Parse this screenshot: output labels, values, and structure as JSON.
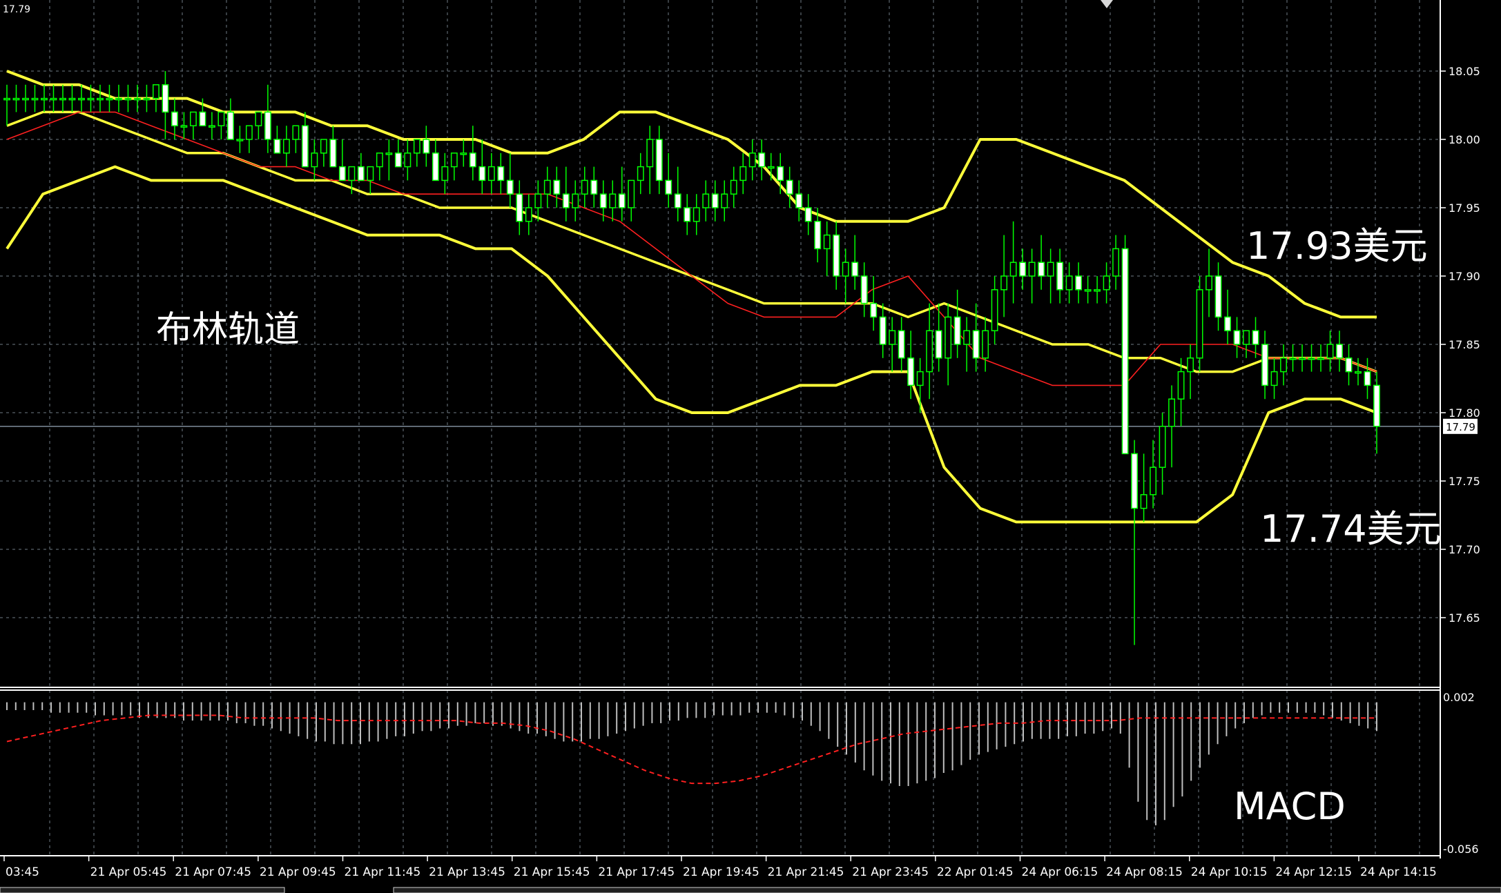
{
  "chart_data": {
    "type": "candlestick",
    "instrument_price_label": "17.79",
    "price_axis": {
      "ticks": [
        "18.05",
        "18.00",
        "17.95",
        "17.90",
        "17.85",
        "17.80",
        "17.75",
        "17.70",
        "17.65"
      ],
      "tick_values": [
        18.05,
        18.0,
        17.95,
        17.9,
        17.85,
        17.8,
        17.75,
        17.7,
        17.65
      ],
      "ylim": [
        17.6,
        18.1
      ],
      "current_price": 17.79,
      "current_price_label": "17.79"
    },
    "time_axis": {
      "labels": [
        "03:45",
        "21 Apr 05:45",
        "21 Apr 07:45",
        "21 Apr 09:45",
        "21 Apr 11:45",
        "21 Apr 13:45",
        "21 Apr 15:45",
        "21 Apr 17:45",
        "21 Apr 19:45",
        "21 Apr 21:45",
        "21 Apr 23:45",
        "22 Apr 01:45",
        "24 Apr 06:15",
        "24 Apr 08:15",
        "24 Apr 10:15",
        "24 Apr 12:15",
        "24 Apr 14:15"
      ]
    },
    "bollinger_upper": [
      18.05,
      18.04,
      18.04,
      18.03,
      18.03,
      18.03,
      18.02,
      18.02,
      18.02,
      18.01,
      18.01,
      18.0,
      18.0,
      18.0,
      17.99,
      17.99,
      18.0,
      18.02,
      18.02,
      18.01,
      18.0,
      17.98,
      17.95,
      17.94,
      17.94,
      17.94,
      17.95,
      18.0,
      18.0,
      17.99,
      17.98,
      17.97,
      17.95,
      17.93,
      17.91,
      17.9,
      17.88,
      17.87,
      17.87
    ],
    "bollinger_middle": [
      18.01,
      18.02,
      18.02,
      18.01,
      18.0,
      17.99,
      17.99,
      17.98,
      17.97,
      17.97,
      17.96,
      17.96,
      17.95,
      17.95,
      17.95,
      17.94,
      17.93,
      17.92,
      17.91,
      17.9,
      17.89,
      17.88,
      17.88,
      17.88,
      17.88,
      17.87,
      17.88,
      17.87,
      17.86,
      17.85,
      17.85,
      17.84,
      17.84,
      17.83,
      17.83,
      17.84,
      17.84,
      17.84,
      17.83
    ],
    "bollinger_lower": [
      17.92,
      17.96,
      17.97,
      17.98,
      17.97,
      17.97,
      17.97,
      17.96,
      17.95,
      17.94,
      17.93,
      17.93,
      17.93,
      17.92,
      17.92,
      17.9,
      17.87,
      17.84,
      17.81,
      17.8,
      17.8,
      17.81,
      17.82,
      17.82,
      17.83,
      17.83,
      17.76,
      17.73,
      17.72,
      17.72,
      17.72,
      17.72,
      17.72,
      17.72,
      17.74,
      17.8,
      17.81,
      17.81,
      17.8
    ],
    "sma_red": [
      18.0,
      18.01,
      18.02,
      18.02,
      18.01,
      18.0,
      17.99,
      17.98,
      17.98,
      17.97,
      17.97,
      17.96,
      17.96,
      17.96,
      17.96,
      17.96,
      17.95,
      17.94,
      17.92,
      17.9,
      17.88,
      17.87,
      17.87,
      17.87,
      17.89,
      17.9,
      17.87,
      17.84,
      17.83,
      17.82,
      17.82,
      17.82,
      17.85,
      17.85,
      17.85,
      17.84,
      17.84,
      17.84,
      17.83
    ],
    "candles": [
      [
        18.03,
        18.04,
        18.01,
        18.03
      ],
      [
        18.03,
        18.04,
        18.02,
        18.03
      ],
      [
        18.03,
        18.04,
        18.02,
        18.03
      ],
      [
        18.03,
        18.04,
        18.02,
        18.03
      ],
      [
        18.03,
        18.04,
        18.02,
        18.03
      ],
      [
        18.03,
        18.04,
        18.02,
        18.03
      ],
      [
        18.03,
        18.04,
        18.02,
        18.03
      ],
      [
        18.03,
        18.04,
        18.02,
        18.03
      ],
      [
        18.03,
        18.04,
        18.02,
        18.03
      ],
      [
        18.03,
        18.04,
        18.02,
        18.03
      ],
      [
        18.03,
        18.04,
        18.02,
        18.03
      ],
      [
        18.03,
        18.04,
        18.02,
        18.03
      ],
      [
        18.03,
        18.04,
        18.02,
        18.03
      ],
      [
        18.03,
        18.04,
        18.02,
        18.03
      ],
      [
        18.03,
        18.04,
        18.02,
        18.03
      ],
      [
        18.03,
        18.04,
        18.02,
        18.03
      ],
      [
        18.03,
        18.04,
        18.02,
        18.04
      ],
      [
        18.04,
        18.05,
        18.0,
        18.02
      ],
      [
        18.02,
        18.03,
        18.0,
        18.01
      ],
      [
        18.01,
        18.02,
        18.0,
        18.01
      ],
      [
        18.01,
        18.02,
        18.0,
        18.02
      ],
      [
        18.02,
        18.03,
        18.01,
        18.01
      ],
      [
        18.01,
        18.02,
        18.0,
        18.01
      ],
      [
        18.01,
        18.02,
        18.0,
        18.02
      ],
      [
        18.02,
        18.03,
        18.0,
        18.0
      ],
      [
        18.0,
        18.01,
        17.99,
        18.0
      ],
      [
        18.0,
        18.01,
        17.99,
        18.01
      ],
      [
        18.01,
        18.02,
        18.0,
        18.02
      ],
      [
        18.02,
        18.04,
        17.99,
        18.0
      ],
      [
        18.0,
        18.01,
        17.99,
        17.99
      ],
      [
        17.99,
        18.01,
        17.98,
        18.0
      ],
      [
        18.0,
        18.01,
        17.99,
        18.01
      ],
      [
        18.01,
        18.02,
        17.98,
        17.98
      ],
      [
        17.98,
        18.0,
        17.97,
        17.99
      ],
      [
        17.99,
        18.0,
        17.98,
        18.0
      ],
      [
        18.0,
        18.01,
        17.98,
        17.98
      ],
      [
        17.98,
        18.0,
        17.97,
        17.97
      ],
      [
        17.97,
        17.98,
        17.96,
        17.98
      ],
      [
        17.98,
        17.99,
        17.97,
        17.97
      ],
      [
        17.97,
        17.98,
        17.96,
        17.98
      ],
      [
        17.98,
        17.99,
        17.97,
        17.99
      ],
      [
        17.99,
        18.0,
        17.97,
        17.99
      ],
      [
        17.99,
        18.0,
        17.98,
        17.98
      ],
      [
        17.98,
        18.0,
        17.97,
        17.99
      ],
      [
        17.99,
        18.0,
        17.98,
        18.0
      ],
      [
        18.0,
        18.01,
        17.98,
        17.99
      ],
      [
        17.99,
        18.0,
        17.97,
        17.97
      ],
      [
        17.97,
        17.99,
        17.96,
        17.98
      ],
      [
        17.98,
        17.99,
        17.97,
        17.99
      ],
      [
        17.99,
        18.0,
        17.98,
        17.99
      ],
      [
        17.99,
        18.01,
        17.97,
        17.98
      ],
      [
        17.98,
        18.0,
        17.96,
        17.97
      ],
      [
        17.97,
        17.99,
        17.96,
        17.98
      ],
      [
        17.98,
        17.99,
        17.96,
        17.97
      ],
      [
        17.97,
        17.99,
        17.95,
        17.96
      ],
      [
        17.96,
        17.97,
        17.93,
        17.94
      ],
      [
        17.94,
        17.96,
        17.93,
        17.95
      ],
      [
        17.95,
        17.97,
        17.94,
        17.96
      ],
      [
        17.96,
        17.98,
        17.95,
        17.97
      ],
      [
        17.97,
        17.98,
        17.95,
        17.96
      ],
      [
        17.96,
        17.98,
        17.94,
        17.95
      ],
      [
        17.95,
        17.97,
        17.94,
        17.96
      ],
      [
        17.96,
        17.98,
        17.95,
        17.97
      ],
      [
        17.97,
        17.98,
        17.95,
        17.96
      ],
      [
        17.96,
        17.97,
        17.94,
        17.95
      ],
      [
        17.95,
        17.97,
        17.94,
        17.96
      ],
      [
        17.96,
        17.98,
        17.94,
        17.95
      ],
      [
        17.95,
        17.97,
        17.94,
        17.97
      ],
      [
        17.97,
        17.99,
        17.96,
        17.98
      ],
      [
        17.98,
        18.01,
        17.96,
        18.0
      ],
      [
        18.0,
        18.01,
        17.96,
        17.97
      ],
      [
        17.97,
        17.99,
        17.95,
        17.96
      ],
      [
        17.96,
        17.98,
        17.94,
        17.95
      ],
      [
        17.95,
        17.96,
        17.93,
        17.94
      ],
      [
        17.94,
        17.96,
        17.93,
        17.95
      ],
      [
        17.95,
        17.97,
        17.94,
        17.96
      ],
      [
        17.96,
        17.97,
        17.94,
        17.95
      ],
      [
        17.95,
        17.97,
        17.94,
        17.96
      ],
      [
        17.96,
        17.98,
        17.95,
        17.97
      ],
      [
        17.97,
        17.99,
        17.96,
        17.98
      ],
      [
        17.98,
        18.0,
        17.97,
        17.99
      ],
      [
        17.99,
        18.0,
        17.97,
        17.98
      ],
      [
        17.98,
        17.99,
        17.97,
        17.98
      ],
      [
        17.98,
        17.99,
        17.96,
        17.97
      ],
      [
        17.97,
        17.98,
        17.95,
        17.96
      ],
      [
        17.96,
        17.97,
        17.94,
        17.95
      ],
      [
        17.95,
        17.96,
        17.93,
        17.94
      ],
      [
        17.94,
        17.95,
        17.91,
        17.92
      ],
      [
        17.92,
        17.94,
        17.9,
        17.93
      ],
      [
        17.93,
        17.94,
        17.89,
        17.9
      ],
      [
        17.9,
        17.92,
        17.88,
        17.91
      ],
      [
        17.91,
        17.93,
        17.89,
        17.9
      ],
      [
        17.9,
        17.91,
        17.87,
        17.88
      ],
      [
        17.88,
        17.9,
        17.86,
        17.87
      ],
      [
        17.87,
        17.88,
        17.84,
        17.85
      ],
      [
        17.85,
        17.87,
        17.83,
        17.86
      ],
      [
        17.86,
        17.87,
        17.83,
        17.84
      ],
      [
        17.84,
        17.86,
        17.81,
        17.82
      ],
      [
        17.82,
        17.84,
        17.8,
        17.83
      ],
      [
        17.83,
        17.88,
        17.81,
        17.86
      ],
      [
        17.86,
        17.88,
        17.83,
        17.84
      ],
      [
        17.84,
        17.88,
        17.82,
        17.87
      ],
      [
        17.87,
        17.89,
        17.84,
        17.85
      ],
      [
        17.85,
        17.87,
        17.83,
        17.86
      ],
      [
        17.86,
        17.88,
        17.83,
        17.84
      ],
      [
        17.84,
        17.87,
        17.83,
        17.86
      ],
      [
        17.86,
        17.9,
        17.85,
        17.89
      ],
      [
        17.89,
        17.93,
        17.87,
        17.9
      ],
      [
        17.9,
        17.94,
        17.88,
        17.91
      ],
      [
        17.91,
        17.92,
        17.89,
        17.9
      ],
      [
        17.9,
        17.92,
        17.88,
        17.91
      ],
      [
        17.91,
        17.93,
        17.89,
        17.9
      ],
      [
        17.9,
        17.92,
        17.88,
        17.91
      ],
      [
        17.91,
        17.92,
        17.88,
        17.89
      ],
      [
        17.89,
        17.91,
        17.88,
        17.9
      ],
      [
        17.9,
        17.91,
        17.88,
        17.89
      ],
      [
        17.89,
        17.9,
        17.88,
        17.89
      ],
      [
        17.89,
        17.9,
        17.88,
        17.89
      ],
      [
        17.89,
        17.91,
        17.88,
        17.9
      ],
      [
        17.9,
        17.93,
        17.89,
        17.92
      ],
      [
        17.92,
        17.93,
        17.84,
        17.77
      ],
      [
        17.77,
        17.78,
        17.63,
        17.73
      ],
      [
        17.73,
        17.77,
        17.72,
        17.74
      ],
      [
        17.74,
        17.78,
        17.73,
        17.76
      ],
      [
        17.76,
        17.8,
        17.74,
        17.79
      ],
      [
        17.79,
        17.82,
        17.76,
        17.81
      ],
      [
        17.81,
        17.84,
        17.79,
        17.83
      ],
      [
        17.83,
        17.85,
        17.81,
        17.84
      ],
      [
        17.84,
        17.9,
        17.83,
        17.89
      ],
      [
        17.89,
        17.92,
        17.87,
        17.9
      ],
      [
        17.9,
        17.91,
        17.86,
        17.87
      ],
      [
        17.87,
        17.89,
        17.85,
        17.86
      ],
      [
        17.86,
        17.87,
        17.84,
        17.85
      ],
      [
        17.85,
        17.86,
        17.84,
        17.86
      ],
      [
        17.86,
        17.87,
        17.84,
        17.85
      ],
      [
        17.85,
        17.86,
        17.81,
        17.82
      ],
      [
        17.82,
        17.84,
        17.81,
        17.83
      ],
      [
        17.83,
        17.85,
        17.82,
        17.84
      ],
      [
        17.84,
        17.85,
        17.83,
        17.84
      ],
      [
        17.84,
        17.85,
        17.83,
        17.84
      ],
      [
        17.84,
        17.85,
        17.83,
        17.84
      ],
      [
        17.84,
        17.85,
        17.83,
        17.84
      ],
      [
        17.84,
        17.86,
        17.83,
        17.85
      ],
      [
        17.85,
        17.86,
        17.83,
        17.84
      ],
      [
        17.84,
        17.85,
        17.82,
        17.83
      ],
      [
        17.83,
        17.84,
        17.82,
        17.83
      ],
      [
        17.83,
        17.84,
        17.81,
        17.82
      ],
      [
        17.82,
        17.83,
        17.77,
        17.79
      ]
    ],
    "macd": {
      "label": "MACD",
      "ylim": [
        -0.056,
        0.002
      ],
      "ticks": [
        "0.002",
        "-0.056"
      ],
      "tick_values": [
        0.002,
        -0.056
      ],
      "histogram": [
        -0.003,
        -0.003,
        -0.003,
        -0.003,
        -0.003,
        -0.004,
        -0.004,
        -0.004,
        -0.004,
        -0.004,
        -0.005,
        -0.005,
        -0.005,
        -0.005,
        -0.005,
        -0.006,
        -0.006,
        -0.006,
        -0.006,
        -0.006,
        -0.007,
        -0.007,
        -0.007,
        -0.007,
        -0.007,
        -0.007,
        -0.008,
        -0.008,
        -0.009,
        -0.009,
        -0.01,
        -0.011,
        -0.012,
        -0.013,
        -0.014,
        -0.015,
        -0.015,
        -0.016,
        -0.016,
        -0.016,
        -0.016,
        -0.015,
        -0.015,
        -0.014,
        -0.013,
        -0.013,
        -0.012,
        -0.011,
        -0.011,
        -0.01,
        -0.01,
        -0.009,
        -0.009,
        -0.008,
        -0.008,
        -0.009,
        -0.009,
        -0.01,
        -0.011,
        -0.012,
        -0.012,
        -0.013,
        -0.014,
        -0.015,
        -0.015,
        -0.015,
        -0.014,
        -0.014,
        -0.013,
        -0.012,
        -0.011,
        -0.01,
        -0.009,
        -0.008,
        -0.008,
        -0.007,
        -0.007,
        -0.006,
        -0.006,
        -0.006,
        -0.005,
        -0.005,
        -0.005,
        -0.005,
        -0.004,
        -0.004,
        -0.004,
        -0.004,
        -0.005,
        -0.006,
        -0.007,
        -0.009,
        -0.011,
        -0.014,
        -0.017,
        -0.02,
        -0.023,
        -0.026,
        -0.028,
        -0.03,
        -0.031,
        -0.032,
        -0.032,
        -0.031,
        -0.03,
        -0.029,
        -0.027,
        -0.026,
        -0.024,
        -0.022,
        -0.02,
        -0.019,
        -0.018,
        -0.017,
        -0.016,
        -0.015,
        -0.014,
        -0.014,
        -0.014,
        -0.014,
        -0.013,
        -0.013,
        -0.012,
        -0.012,
        -0.011,
        -0.01,
        -0.012,
        -0.025,
        -0.038,
        -0.045,
        -0.047,
        -0.045,
        -0.04,
        -0.036,
        -0.03,
        -0.025,
        -0.02,
        -0.016,
        -0.013,
        -0.01,
        -0.008,
        -0.006,
        -0.005,
        -0.004,
        -0.004,
        -0.004,
        -0.004,
        -0.004,
        -0.004,
        -0.005,
        -0.006,
        -0.007,
        -0.008,
        -0.009,
        -0.01,
        -0.011
      ],
      "signal": [
        -0.015,
        -0.013,
        -0.011,
        -0.009,
        -0.007,
        -0.006,
        -0.005,
        -0.005,
        -0.005,
        -0.005,
        -0.006,
        -0.006,
        -0.006,
        -0.006,
        -0.007,
        -0.007,
        -0.007,
        -0.007,
        -0.007,
        -0.007,
        -0.008,
        -0.008,
        -0.009,
        -0.011,
        -0.014,
        -0.018,
        -0.022,
        -0.026,
        -0.029,
        -0.031,
        -0.031,
        -0.03,
        -0.028,
        -0.025,
        -0.022,
        -0.019,
        -0.016,
        -0.014,
        -0.012,
        -0.011,
        -0.01,
        -0.009,
        -0.008,
        -0.008,
        -0.007,
        -0.007,
        -0.007,
        -0.007,
        -0.006,
        -0.006,
        -0.006,
        -0.006,
        -0.006,
        -0.006,
        -0.006,
        -0.006,
        -0.006,
        -0.006,
        -0.006
      ]
    }
  },
  "annotations": {
    "bollinger_title": "布林轨道",
    "upper_price": "17.93美元",
    "lower_price": "17.74美元",
    "macd_title": "MACD"
  },
  "colors": {
    "background": "#000000",
    "grid": "#6f7b86",
    "bollinger": "#ffff3a",
    "sma": "#ff2020",
    "candle": "#00ff00",
    "candle_bull_body": "#000000",
    "candle_bear_body": "#ffffff",
    "axis_text": "#ffffff",
    "macd_hist": "#bfbfbf",
    "macd_signal": "#ff2020"
  }
}
